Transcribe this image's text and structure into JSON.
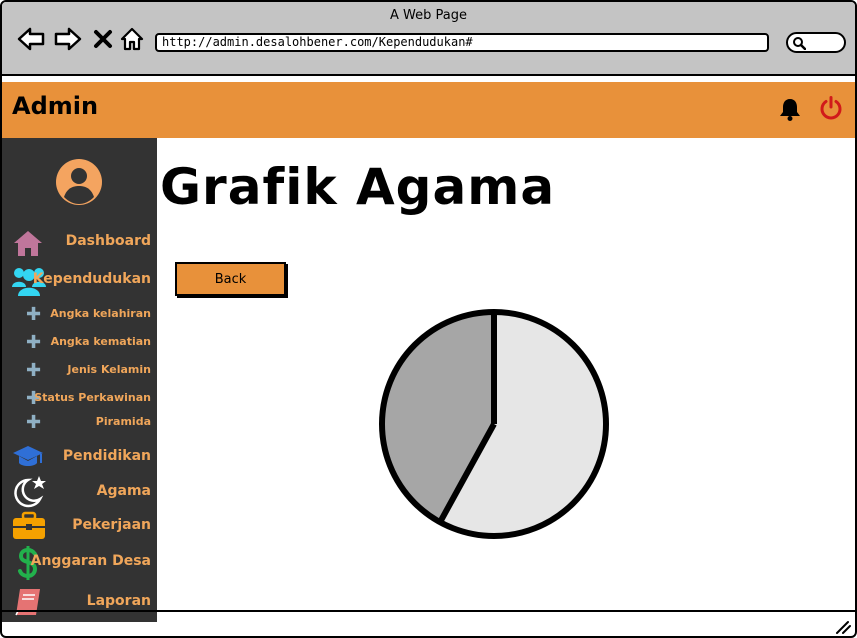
{
  "browser": {
    "window_title": "A Web Page",
    "url": "http://admin.desalohbener.com/Kependudukan#"
  },
  "header": {
    "title": "Admin",
    "accent_color": "#e8913a"
  },
  "sidebar": {
    "background": "#333333",
    "items": [
      {
        "label": "Dashboard",
        "icon": "home-icon"
      },
      {
        "label": "Kependudukan",
        "icon": "users-icon"
      },
      {
        "label": "Pendidikan",
        "icon": "graduation-cap-icon"
      },
      {
        "label": "Agama",
        "icon": "moon-star-icon"
      },
      {
        "label": "Pekerjaan",
        "icon": "briefcase-icon"
      },
      {
        "label": "Anggaran Desa",
        "icon": "dollar-icon"
      },
      {
        "label": "Laporan",
        "icon": "book-icon"
      }
    ],
    "subitems": [
      {
        "label": "Angka kelahiran"
      },
      {
        "label": "Angka kematian"
      },
      {
        "label": "Jenis Kelamin"
      },
      {
        "label": "Status Perkawinan"
      },
      {
        "label": "Piramida"
      }
    ]
  },
  "main": {
    "title": "Grafik Agama",
    "back_label": "Back"
  },
  "chart_data": {
    "type": "pie",
    "values": [
      58,
      42
    ],
    "colors": [
      "#e6e6e6",
      "#a6a6a6"
    ]
  }
}
